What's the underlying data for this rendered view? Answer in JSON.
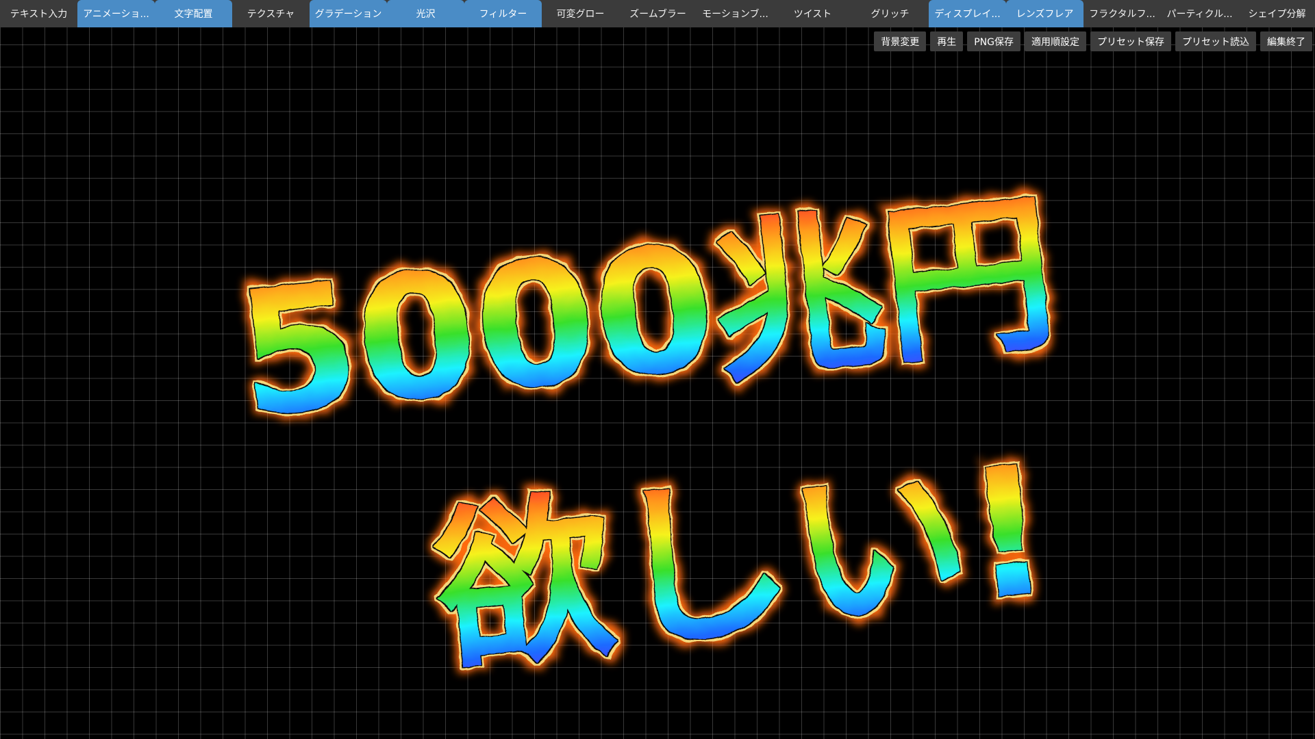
{
  "tabs": [
    {
      "label": "テキスト入力",
      "active": false
    },
    {
      "label": "アニメーショ...",
      "active": true
    },
    {
      "label": "文字配置",
      "active": true
    },
    {
      "label": "テクスチャ",
      "active": false
    },
    {
      "label": "グラデーション",
      "active": true
    },
    {
      "label": "光沢",
      "active": true
    },
    {
      "label": "フィルター",
      "active": true
    },
    {
      "label": "可変グロー",
      "active": false
    },
    {
      "label": "ズームブラー",
      "active": false
    },
    {
      "label": "モーションブ...",
      "active": false
    },
    {
      "label": "ツイスト",
      "active": false
    },
    {
      "label": "グリッチ",
      "active": false
    },
    {
      "label": "ディスプレイ...",
      "active": true
    },
    {
      "label": "レンズフレア",
      "active": true
    },
    {
      "label": "フラクタルフ...",
      "active": false
    },
    {
      "label": "パーティクル...",
      "active": false
    },
    {
      "label": "シェイプ分解",
      "active": false
    }
  ],
  "actions": {
    "background": "背景変更",
    "play": "再生",
    "png_save": "PNG保存",
    "apply_order": "適用順設定",
    "preset_save": "プリセット保存",
    "preset_load": "プリセット読込",
    "exit_edit": "編集終了"
  },
  "artwork": {
    "line1": "5000兆円",
    "line2": "欲しい!"
  },
  "colors": {
    "tab_bar": "#3b3b3b",
    "tab_active": "#4a8cc6",
    "button_bg": "#3d3d3d",
    "canvas_bg": "#000000",
    "grid": "#555555",
    "glow": "#ff7a1a",
    "outline": "#f3d774"
  }
}
